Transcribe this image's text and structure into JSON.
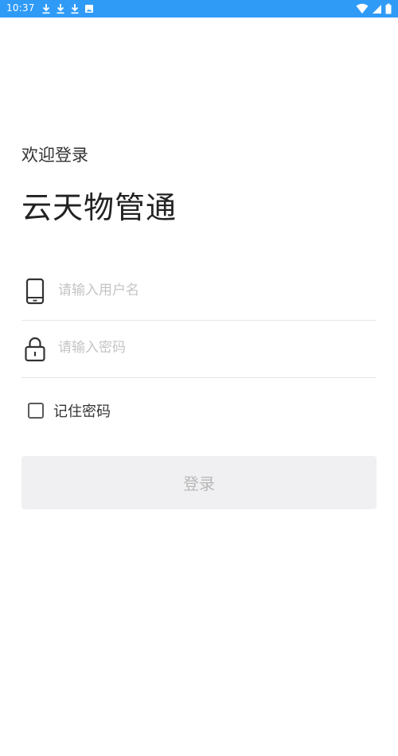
{
  "status_bar": {
    "time": "10:37",
    "left_icons": [
      "download-icon",
      "download-icon",
      "download-icon",
      "photo-icon"
    ],
    "right_icons": [
      "wifi-icon",
      "signal-icon",
      "battery-icon"
    ],
    "background": "#2f9bf7"
  },
  "header": {
    "welcome": "欢迎登录",
    "app_name": "云天物管通"
  },
  "form": {
    "username": {
      "icon": "phone-icon",
      "placeholder": "请输入用户名",
      "value": ""
    },
    "password": {
      "icon": "lock-icon",
      "placeholder": "请输入密码",
      "value": ""
    },
    "remember": {
      "label": "记住密码",
      "checked": false
    },
    "login_label": "登录"
  },
  "colors": {
    "accent": "#2f9bf7",
    "button_bg": "#f0f0f2",
    "button_text": "#b8b8b8",
    "placeholder": "#c4c4c4"
  }
}
